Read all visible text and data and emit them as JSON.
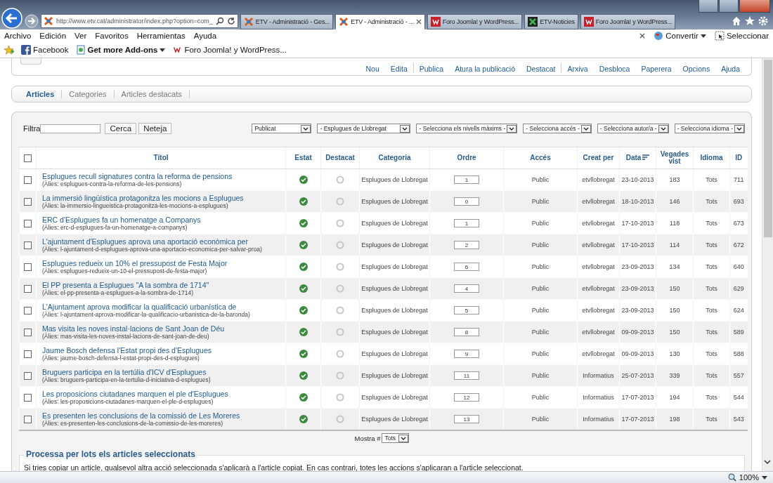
{
  "browser": {
    "address": "http://www.etv.cat/administrator/index.php?option=com_",
    "tabs": [
      {
        "title": "ETV - Administració - Ges...",
        "selected": false,
        "kind": "joomla"
      },
      {
        "title": "ETV - Administració - ...",
        "selected": true,
        "kind": "joomla"
      },
      {
        "title": "Foro Joomla! y WordPress...",
        "selected": false,
        "kind": "foro"
      },
      {
        "title": "ETV-Noticies",
        "selected": false,
        "kind": "etv"
      },
      {
        "title": "Foro Joomla! y WordPress...",
        "selected": false,
        "kind": "foro"
      }
    ],
    "menu": [
      "Archivo",
      "Edición",
      "Ver",
      "Favoritos",
      "Herramientas",
      "Ayuda"
    ],
    "convert": "Convertir",
    "select": "Seleccionar",
    "favorites": [
      {
        "label": "Facebook",
        "kind": "facebook"
      },
      {
        "label": "Get more Add-ons",
        "kind": "addons"
      },
      {
        "label": "Foro Joomla! y WordPress...",
        "kind": "foro"
      }
    ],
    "zoom": "100%"
  },
  "toolbar": [
    "Nou",
    "Edita",
    "Publica",
    "Atura la publicació",
    "Destacat",
    "Arxiva",
    "Desbloca",
    "Paperera",
    "Opcions",
    "Ajuda"
  ],
  "subtabs": [
    {
      "label": "Articles",
      "selected": true
    },
    {
      "label": "Categories",
      "selected": false
    },
    {
      "label": "Articles destacats",
      "selected": false
    }
  ],
  "filter": {
    "label": "Filtra",
    "search_button": "Cerca",
    "clear_button": "Neteja",
    "selects": [
      "Publicat",
      "- Esplugues de Llobregat",
      "- Selecciona els nivells màxims -",
      "- Selecciona accés -",
      "- Selecciona autor/a -",
      "- Selecciona idioma -"
    ]
  },
  "table": {
    "select_all": {
      "checked": false
    },
    "columns": [
      "Títol",
      "Estat",
      "Destacat",
      "Categoria",
      "Ordre",
      "Accés",
      "Creat per",
      "Data",
      "Vegades vist",
      "Idioma",
      "ID"
    ],
    "rows": [
      {
        "checked": false,
        "title": "Esplugues recull signatures contra la reforma de pensions",
        "alias": "(Àlies: esplugues-contra-la-reforma-de-les-pensions)",
        "published": true,
        "featured": false,
        "category": "Esplugues de Llobregat",
        "order": "1",
        "access": "Public",
        "created_by": "etvllobregat",
        "date": "23-10-2013",
        "hits": "183",
        "language": "Tots",
        "id": "711"
      },
      {
        "checked": false,
        "title": "La immersió lingüística protagonitza les mocions a Esplugues",
        "alias": "(Àlies: la-immersio-lingueistica-protagonitza-les-mocions-a-esplugues)",
        "published": true,
        "featured": false,
        "category": "Esplugues de Llobregat",
        "order": "0",
        "access": "Public",
        "created_by": "etvllobregat",
        "date": "18-10-2013",
        "hits": "146",
        "language": "Tots",
        "id": "693"
      },
      {
        "checked": false,
        "title": "ERC d'Esplugues fa un homenatge a Companys",
        "alias": "(Àlies: erc-d-esplugues-fa-un-homenatge-a-companys)",
        "published": true,
        "featured": false,
        "category": "Esplugues de Llobregat",
        "order": "1",
        "access": "Public",
        "created_by": "etvllobregat",
        "date": "17-10-2013",
        "hits": "118",
        "language": "Tots",
        "id": "673"
      },
      {
        "checked": false,
        "title": "L'ajuntament d'Esplugues aprova una aportació econòmica per",
        "alias": "(Àlies: l-ajuntament-d-esplugues-aprova-una-aportacio-economica-per-salvar-proa)",
        "published": true,
        "featured": false,
        "category": "Esplugues de Llobregat",
        "order": "2",
        "access": "Public",
        "created_by": "etvllobregat",
        "date": "17-10-2013",
        "hits": "114",
        "language": "Tots",
        "id": "672"
      },
      {
        "checked": false,
        "title": "Esplugues redueix un 10% el pressupost de Festa Major",
        "alias": "(Àlies: esplugues-redueix-un-10-el-pressupost-de-festa-major)",
        "published": true,
        "featured": false,
        "category": "Esplugues de Llobregat",
        "order": "6",
        "access": "Public",
        "created_by": "etvllobregat",
        "date": "23-09-2013",
        "hits": "134",
        "language": "Tots",
        "id": "640"
      },
      {
        "checked": false,
        "title": "El PP presenta a Esplugues \"A la sombra de 1714\"",
        "alias": "(Àlies: el-pp-presenta-a-esplugues-a-la-sombra-de-1714)",
        "published": true,
        "featured": false,
        "category": "Esplugues de Llobregat",
        "order": "4",
        "access": "Public",
        "created_by": "etvllobregat",
        "date": "23-09-2013",
        "hits": "150",
        "language": "Tots",
        "id": "629"
      },
      {
        "checked": false,
        "title": "L'Ajuntament aprova modificar la qualificació urbanística de",
        "alias": "(Àlies: l-ajuntament-aprova-modificar-la-qualificacio-urbanistica-de-la-baronda)",
        "published": true,
        "featured": false,
        "category": "Esplugues de Llobregat",
        "order": "5",
        "access": "Public",
        "created_by": "etvllobregat",
        "date": "23-09-2013",
        "hits": "150",
        "language": "Tots",
        "id": "624"
      },
      {
        "checked": false,
        "title": "Mas visita les noves instal·lacions de Sant Joan de Déu",
        "alias": "(Àlies: mas-visita-les-noves-instal-lacions-de-sant-joan-de-deu)",
        "published": true,
        "featured": false,
        "category": "Esplugues de Llobregat",
        "order": "8",
        "access": "Public",
        "created_by": "etvllobregat",
        "date": "09-09-2013",
        "hits": "150",
        "language": "Tots",
        "id": "589"
      },
      {
        "checked": false,
        "title": "Jaume Bosch defensa l'Estat propi des d'Esplugues",
        "alias": "(Àlies: jaume-bosch-defensa-l-estat-propi-des-d-esplugues)",
        "published": true,
        "featured": false,
        "category": "Esplugues de Llobregat",
        "order": "9",
        "access": "Public",
        "created_by": "etvllobregat",
        "date": "09-09-2013",
        "hits": "130",
        "language": "Tots",
        "id": "588"
      },
      {
        "checked": false,
        "title": "Bruguers participa en la tertúlia d'ICV d'Esplugues",
        "alias": "(Àlies: bruguers-participa-en-la-tertulia-d-iniciativa-d-esplugues)",
        "published": true,
        "featured": false,
        "category": "Esplugues de Llobregat",
        "order": "11",
        "access": "Public",
        "created_by": "Informatius",
        "date": "25-07-2013",
        "hits": "339",
        "language": "Tots",
        "id": "557"
      },
      {
        "checked": false,
        "title": "Les proposicions ciutadanes marquen el ple d'Esplugues",
        "alias": "(Àlies: les-proposicions-ciutadanes-marquen-el-ple-d-esplugues)",
        "published": true,
        "featured": false,
        "category": "Esplugues de Llobregat",
        "order": "12",
        "access": "Public",
        "created_by": "Informatius",
        "date": "17-07-2013",
        "hits": "194",
        "language": "Tots",
        "id": "544"
      },
      {
        "checked": false,
        "title": "Es presenten les conclusions de la comissió de Les Moreres",
        "alias": "(Àlies: es-presenten-les-conclusions-de-la-comissio-de-les-moreres)",
        "published": true,
        "featured": false,
        "category": "Esplugues de Llobregat",
        "order": "13",
        "access": "Public",
        "created_by": "Informatius",
        "date": "17-07-2013",
        "hits": "198",
        "language": "Tots",
        "id": "543"
      }
    ]
  },
  "pagination": {
    "label": "Mostra #",
    "value": "Tots"
  },
  "batch": {
    "title": "Processa per lots els articles seleccionats",
    "text": "Si tries copiar un article, qualsevol altra acció seleccionada s'aplicarà a l'article copiat. En cas contrari, totes les accions s'aplicaran a l'article seleccionat."
  }
}
